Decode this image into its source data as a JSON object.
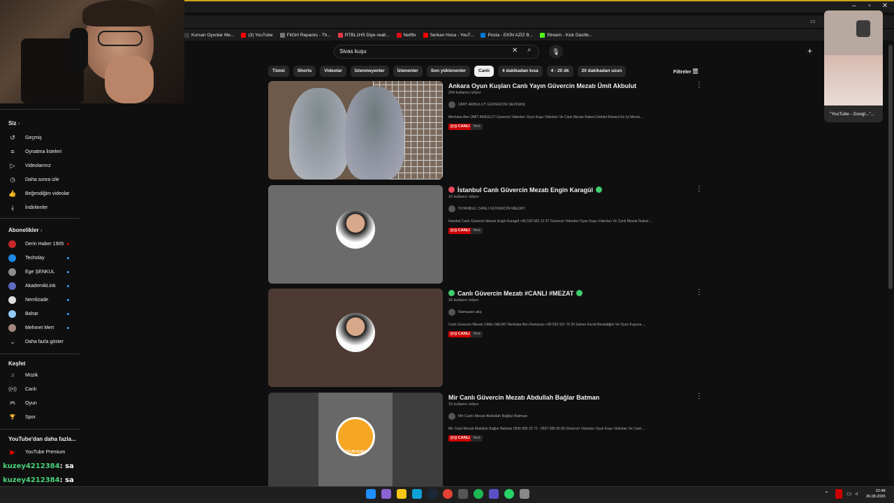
{
  "browser": {
    "bookmarks": [
      {
        "label": "Korsan Oyunlar Me...",
        "color": "#3b3b3b"
      },
      {
        "label": "(3) YouTube",
        "color": "#ff0000"
      },
      {
        "label": "FitGirl Repacks - Th...",
        "color": "#777777"
      },
      {
        "label": "RTBL1HS Diye realt...",
        "color": "#e63946"
      },
      {
        "label": "Netflix",
        "color": "#e50914"
      },
      {
        "label": "Serkan Hoca - YouT...",
        "color": "#ff0000"
      },
      {
        "label": "Posta - EKİN AZİZ B...",
        "color": "#0078d4"
      },
      {
        "label": "Stream - Kick Dashb...",
        "color": "#53fc18"
      }
    ]
  },
  "search": {
    "query": "Sivas kuşu"
  },
  "chips": [
    "Tümü",
    "Shorts",
    "Videolar",
    "İzlenmeyenler",
    "İzlenenler",
    "Son yüklenenler",
    "Canlı",
    "4 dakikadan kısa",
    "4 - 20 dk",
    "20 dakikadan uzun"
  ],
  "active_chip": "Canlı",
  "filters_label": "Filtreler",
  "sidebar": {
    "you_title": "Siz",
    "you_items": [
      {
        "icon": "history-icon",
        "label": "Geçmiş"
      },
      {
        "icon": "playlist-icon",
        "label": "Oynatma listeleri"
      },
      {
        "icon": "your-videos-icon",
        "label": "Videolarınız"
      },
      {
        "icon": "watch-later-icon",
        "label": "Daha sonra izle"
      },
      {
        "icon": "like-icon",
        "label": "Beğendiğim videolar"
      },
      {
        "icon": "download-icon",
        "label": "İndirilenler"
      }
    ],
    "subs_title": "Abonelikler",
    "subs": [
      {
        "label": "Derin Haber 1905",
        "color": "#c62828",
        "live": true
      },
      {
        "label": "Techolay",
        "color": "#1e88e5",
        "live": false
      },
      {
        "label": "Ege ŞENKUL",
        "color": "#8d8d8d",
        "live": false
      },
      {
        "label": "AkademikLink",
        "color": "#5c6bc0",
        "live": false
      },
      {
        "label": "Nemlizade",
        "color": "#dddddd",
        "live": false
      },
      {
        "label": "Bahar",
        "color": "#90caf9",
        "live": false
      },
      {
        "label": "Mehmet Mert",
        "color": "#a1887f",
        "live": false
      }
    ],
    "show_more": "Daha fazla göster",
    "explore_title": "Keşfet",
    "explore_items": [
      {
        "icon": "music-icon",
        "label": "Müzik"
      },
      {
        "icon": "live-icon",
        "label": "Canlı"
      },
      {
        "icon": "gaming-icon",
        "label": "Oyun"
      },
      {
        "icon": "sports-icon",
        "label": "Spor"
      }
    ],
    "more_title": "YouTube'dan daha fazla...",
    "premium": "YouTube Premium"
  },
  "results": [
    {
      "title": "Ankara Oyun Kuşları Canlı Yayın Güvercin Mezatı Ümit Akbulut",
      "viewers": "204 kullanıcı izliyor",
      "channel": "ÜMİT AKBULUT GÜVERCİN SEVDASI",
      "description": "Merhaba Ben ÜMİT AKBULUT Güvercin Videoları Oyun Kuşu Videoları Ve Canlı Mezatı İhalesi Üretimi Kümesi En İyi Mezat ...",
      "live_label": "CANLI",
      "new_label": "Yeni",
      "thumb_bg": "#6d5a4a"
    },
    {
      "title": "İstanbul Canlı Güvercin Mezatı Engin Karagül",
      "viewers": "16 kullanıcı izliyor",
      "channel": "İSTANBUL CANLI GÜVERCİN MEZATI",
      "description": "İstanbul Canlı Güvercin Mezatı Engin Karagül +90 530 582 12 57 Güvercin Videoları Oyun Kuşu Videoları Ve Canlı Mezatı İhalesi ...",
      "live_label": "CANLI",
      "new_label": "Yeni",
      "thumb_bg": "#6b6b6b"
    },
    {
      "title": "Canlı Güvercin Mezatı #CANLI #MEZAT",
      "viewers": "26 kullanıcı izliyor",
      "channel": "Ramazan akş",
      "description": "Canlı Güvercin Mezatı CANLI MEZAT Merhaba Ben Ramazan +90 530 101 76 20 Sizlere Kendi Beslediğim Ve Oyun Kuşuna ...",
      "live_label": "CANLI",
      "new_label": "Yeni",
      "thumb_bg": "#4d3b33"
    },
    {
      "title": "Mir Canlı Güvercin Mezatı Abdullah Bağlar Batman",
      "viewers": "15 kullanıcı izliyor",
      "channel": "Mir Canlı Mezat Abdullah Bağlar Batman",
      "description": "Mir Canlı Mezatı Abdullah Bağlar Batman 0536 680 20 72 - 0507 089 90 60 Güvercin Videoları Oyun Kuşu Videoları Ve Canlı ...",
      "live_label": "CANLI",
      "new_label": "Yeni",
      "thumb_bg": "#3e3e3e",
      "logo_text": "OYUN KUŞU"
    }
  ],
  "popup": {
    "label": "\"YouTube - Googl...\"..."
  },
  "chat": [
    {
      "user": "kuzey4212384",
      "message": ": sa"
    },
    {
      "user": "kuzey4212384",
      "message": ": sa"
    },
    {
      "user": "kuzey4212384",
      "message": ": sa"
    }
  ],
  "clock": {
    "time": "22:48",
    "date": "26.08.2025"
  }
}
